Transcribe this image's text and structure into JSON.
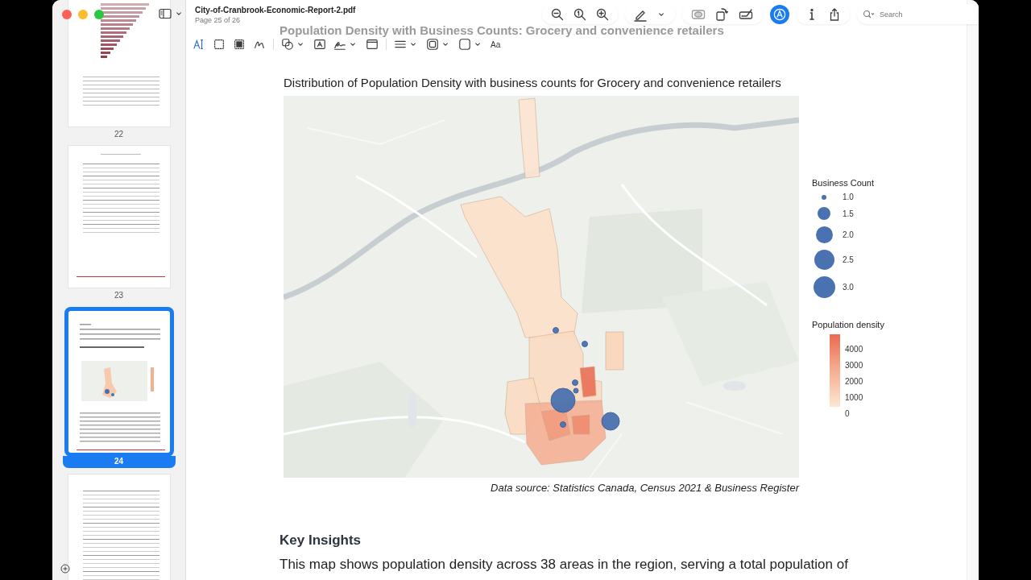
{
  "window": {
    "title": "City-of-Cranbrook-Economic-Report-2.pdf",
    "subtitle": "Page 25 of 26"
  },
  "sidebar": {
    "thumbnails": [
      {
        "label": "22",
        "selected": false,
        "kind": "chart"
      },
      {
        "label": "23",
        "selected": false,
        "kind": "table"
      },
      {
        "label": "24",
        "selected": true,
        "kind": "map"
      },
      {
        "selected": false,
        "kind": "long-table"
      }
    ]
  },
  "markup_toolbar": {
    "tools": [
      {
        "kind": "text-select"
      },
      {
        "kind": "rect-select"
      },
      {
        "kind": "redact"
      },
      {
        "kind": "sketch"
      },
      {
        "kind": "divider"
      },
      {
        "kind": "shapes"
      },
      {
        "kind": "text-box"
      },
      {
        "kind": "sign"
      },
      {
        "kind": "page-box"
      },
      {
        "kind": "divider"
      },
      {
        "kind": "line-style"
      },
      {
        "kind": "border-color"
      },
      {
        "kind": "fill-color"
      },
      {
        "kind": "font",
        "label": "Aa"
      }
    ]
  },
  "toolbar": {
    "groups": [
      {
        "tools": [
          {
            "kind": "zoom-out"
          },
          {
            "kind": "actual-size"
          },
          {
            "kind": "zoom-in"
          }
        ]
      },
      {
        "tools": [
          {
            "kind": "highlight"
          },
          {
            "kind": "chevron"
          }
        ]
      },
      {
        "tools": [
          {
            "kind": "redact-box"
          },
          {
            "kind": "rotate"
          },
          {
            "kind": "form-sign"
          }
        ]
      },
      {
        "tools": [
          {
            "kind": "markup",
            "on": true
          }
        ]
      },
      {
        "tools": [
          {
            "kind": "info"
          },
          {
            "kind": "share"
          }
        ]
      }
    ]
  },
  "search": {
    "placeholder": "Search"
  },
  "document": {
    "faded_heading": "Population Density with Business Counts: Grocery and convenience retailers",
    "figure": {
      "title": "Distribution of Population Density with business counts for Grocery and convenience retailers",
      "size_legend": {
        "title": "Business Count",
        "entries": [
          "1.0",
          "1.5",
          "2.0",
          "2.5",
          "3.0"
        ]
      },
      "color_legend": {
        "title": "Population density",
        "ticks": [
          "4000",
          "3000",
          "2000",
          "1000",
          "0"
        ]
      },
      "caption": "Data source: Statistics Canada, Census 2021 & Business Register"
    },
    "section_heading": "Key Insights",
    "paragraph": "This map shows population density across 38 areas in the region, serving a total population of"
  }
}
